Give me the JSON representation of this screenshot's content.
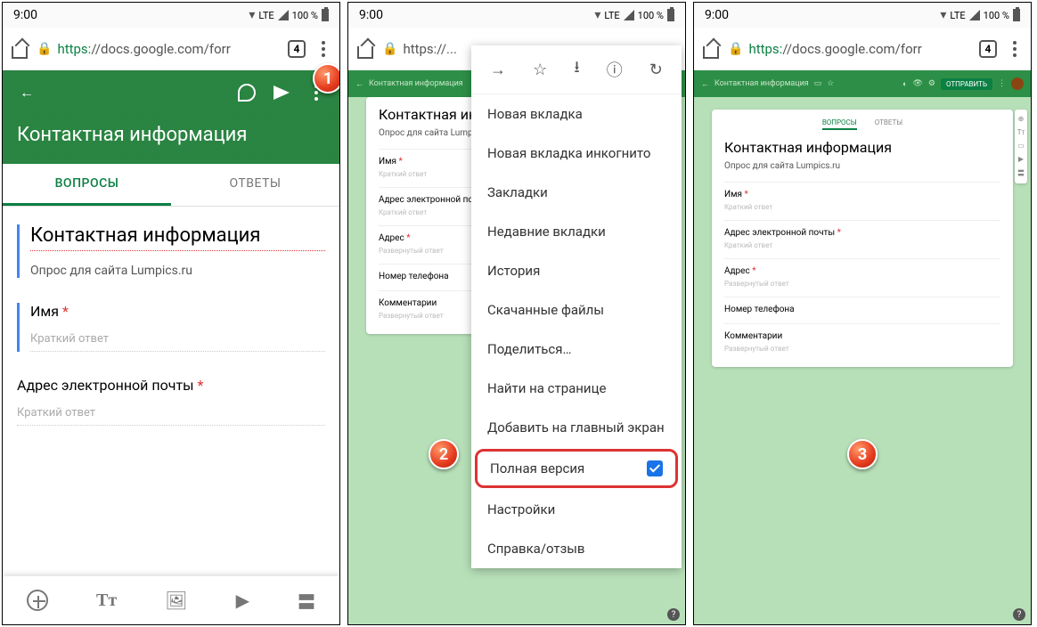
{
  "status": {
    "time": "9:00",
    "lte": "LTE",
    "battery": "100 %"
  },
  "browser": {
    "url_https": "https:",
    "url_rest": "//docs.google.com/forr",
    "url_short": "https://...",
    "tab_count": "4"
  },
  "forms": {
    "title": "Контактная информация",
    "desc": "Опрос для сайта Lumpics.ru",
    "tabs": {
      "questions": "ВОПРОСЫ",
      "answers": "ОТВЕТЫ"
    },
    "q_title": "Контактная информация",
    "fields": {
      "name": "Имя",
      "email": "Адрес электронной почты",
      "address": "Адрес",
      "phone": "Номер телефона",
      "comments": "Комментарии"
    },
    "short_answer": "Краткий ответ",
    "long_answer": "Развернутый ответ",
    "send": "ОТПРАВИТЬ"
  },
  "menu": {
    "new_tab": "Новая вкладка",
    "incognito": "Новая вкладка инкогнито",
    "bookmarks": "Закладки",
    "recent": "Недавние вкладки",
    "history": "История",
    "downloads": "Скачанные файлы",
    "share": "Поделиться…",
    "find": "Найти на странице",
    "add_home": "Добавить на главный экран",
    "desktop": "Полная версия",
    "settings": "Настройки",
    "help": "Справка/отзыв"
  },
  "badges": {
    "s1": "1",
    "s2": "2",
    "s3": "3"
  }
}
